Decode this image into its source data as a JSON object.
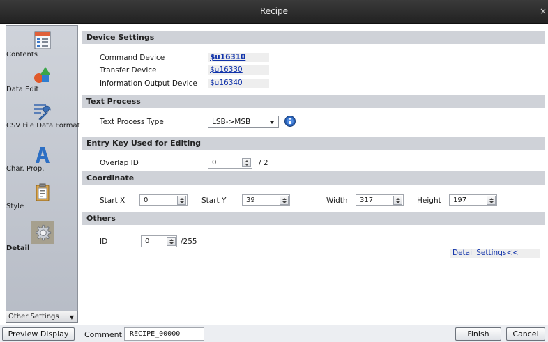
{
  "window": {
    "title": "Recipe",
    "close_glyph": "×"
  },
  "sidebar": {
    "items": [
      {
        "name": "contents",
        "label": "Contents",
        "icon": "contents-icon"
      },
      {
        "name": "data-edit",
        "label": "Data Edit",
        "icon": "shapes-icon"
      },
      {
        "name": "csv-file-data-format",
        "label": "CSV File Data Format",
        "icon": "wrench-icon"
      },
      {
        "name": "char-prop",
        "label": "Char. Prop.",
        "icon": "letter-a-icon"
      },
      {
        "name": "style",
        "label": "Style",
        "icon": "clipboard-icon"
      },
      {
        "name": "detail",
        "label": "Detail",
        "icon": "gear-icon",
        "selected": true
      }
    ],
    "other_settings": "Other Settings"
  },
  "device_settings": {
    "header": "Device Settings",
    "command_device_label": "Command Device",
    "command_device_value": "$u16310",
    "transfer_device_label": "Transfer Device",
    "transfer_device_value": "$u16330",
    "info_output_label": "Information Output Device",
    "info_output_value": "$u16340"
  },
  "text_process": {
    "header": "Text Process",
    "type_label": "Text Process Type",
    "type_value": "LSB->MSB"
  },
  "entry_key": {
    "header": "Entry Key Used for Editing",
    "overlap_label": "Overlap ID",
    "overlap_value": "0",
    "overlap_max": "/ 2"
  },
  "coordinate": {
    "header": "Coordinate",
    "start_x_label": "Start X",
    "start_x": "0",
    "start_y_label": "Start Y",
    "start_y": "39",
    "width_label": "Width",
    "width": "317",
    "height_label": "Height",
    "height": "197"
  },
  "others": {
    "header": "Others",
    "id_label": "ID",
    "id_value": "0",
    "id_max": "/255",
    "detail_settings": "Detail Settings<<"
  },
  "footer": {
    "preview_display": "Preview Display",
    "comment_label": "Comment",
    "comment_value": "RECIPE_00000",
    "finish": "Finish",
    "cancel": "Cancel"
  },
  "colors": {
    "accent": "#1133aa",
    "header_bg": "#cfd2d8",
    "sidebar_bg": "#c4c8d0"
  }
}
